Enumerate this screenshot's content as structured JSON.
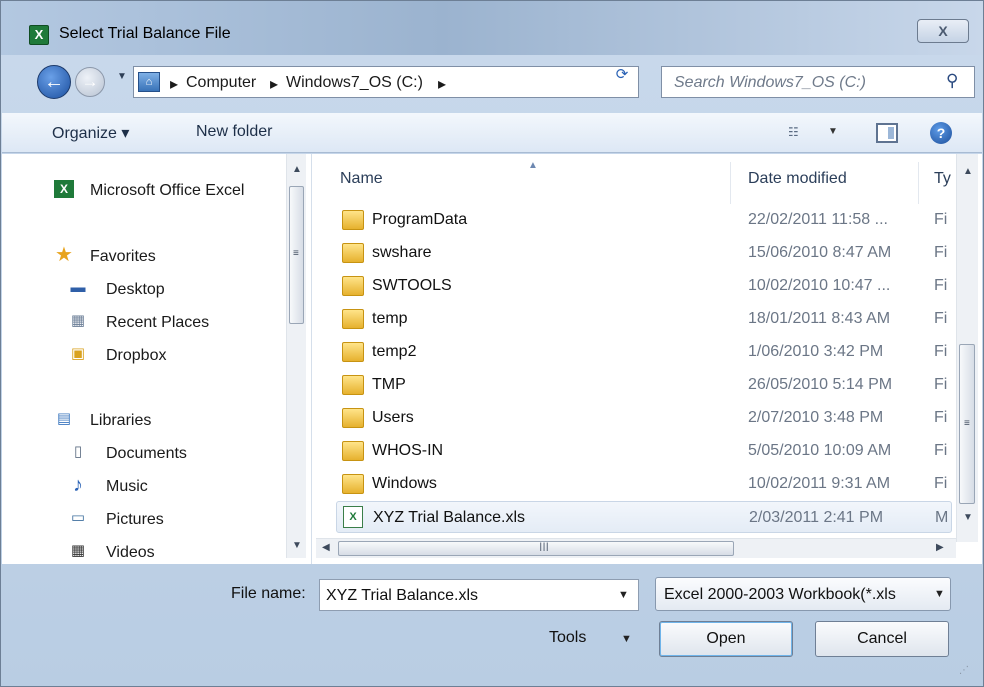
{
  "window": {
    "title": "Select Trial Balance File",
    "title_icon": "excel-icon",
    "close_label": "X"
  },
  "nav": {
    "back_label": "←",
    "forward_label": "→",
    "recent_label": "▼",
    "address": {
      "icon": "computer-icon",
      "segments": [
        "Computer",
        "Windows7_OS (C:)"
      ],
      "sep": "▸"
    },
    "address_drop": "▼",
    "refresh_label": "⟳",
    "search_placeholder": "Search Windows7_OS (C:)",
    "search_icon_label": "⚲"
  },
  "toolbar": {
    "organize_label": "Organize ▾",
    "new_folder_label": "New folder",
    "views_label": "☷",
    "views_drop": "▼",
    "help_label": "?"
  },
  "sidebar": {
    "items": [
      {
        "label": "Microsoft Office Excel",
        "icon": "excel-icon",
        "glyph": "X",
        "indent": false
      },
      {
        "label": "Favorites",
        "icon": "star-icon",
        "glyph": "★",
        "indent": false
      },
      {
        "label": "Desktop",
        "icon": "desktop-icon",
        "glyph": "▬",
        "indent": true
      },
      {
        "label": "Recent Places",
        "icon": "recent-places-icon",
        "glyph": "▦",
        "indent": true
      },
      {
        "label": "Dropbox",
        "icon": "dropbox-icon",
        "glyph": "▣",
        "indent": true
      },
      {
        "label": "Libraries",
        "icon": "library-icon",
        "glyph": "▤",
        "indent": false
      },
      {
        "label": "Documents",
        "icon": "documents-icon",
        "glyph": "▯",
        "indent": true
      },
      {
        "label": "Music",
        "icon": "music-icon",
        "glyph": "♪",
        "indent": true
      },
      {
        "label": "Pictures",
        "icon": "pictures-icon",
        "glyph": "▭",
        "indent": true
      },
      {
        "label": "Videos",
        "icon": "videos-icon",
        "glyph": "▦",
        "indent": true
      }
    ]
  },
  "file_list": {
    "headers": {
      "name": "Name",
      "date": "Date modified",
      "type": "Ty"
    },
    "rows": [
      {
        "name": "ProgramData",
        "date": "22/02/2011 11:58 ...",
        "type": "Fi",
        "kind": "folder"
      },
      {
        "name": "swshare",
        "date": "15/06/2010 8:47 AM",
        "type": "Fi",
        "kind": "folder"
      },
      {
        "name": "SWTOOLS",
        "date": "10/02/2010 10:47 ...",
        "type": "Fi",
        "kind": "folder"
      },
      {
        "name": "temp",
        "date": "18/01/2011 8:43 AM",
        "type": "Fi",
        "kind": "folder"
      },
      {
        "name": "temp2",
        "date": "1/06/2010 3:42 PM",
        "type": "Fi",
        "kind": "folder"
      },
      {
        "name": "TMP",
        "date": "26/05/2010 5:14 PM",
        "type": "Fi",
        "kind": "folder"
      },
      {
        "name": "Users",
        "date": "2/07/2010 3:48 PM",
        "type": "Fi",
        "kind": "folder"
      },
      {
        "name": "WHOS-IN",
        "date": "5/05/2010 10:09 AM",
        "type": "Fi",
        "kind": "folder"
      },
      {
        "name": "Windows",
        "date": "10/02/2011 9:31 AM",
        "type": "Fi",
        "kind": "folder"
      },
      {
        "name": "XYZ Trial Balance.xls",
        "date": "2/03/2011 2:41 PM",
        "type": "M",
        "kind": "excel-file",
        "selected": true
      }
    ],
    "hscroll_grip": "III"
  },
  "bottom": {
    "file_name_label": "File name:",
    "file_name_value": "XYZ Trial Balance.xls",
    "file_name_drop": "▼",
    "filter_value": "Excel 2000-2003 Workbook(*.xls",
    "filter_drop": "▼",
    "tools_label": "Tools",
    "tools_drop": "▼",
    "open_label": "Open",
    "cancel_label": "Cancel"
  }
}
